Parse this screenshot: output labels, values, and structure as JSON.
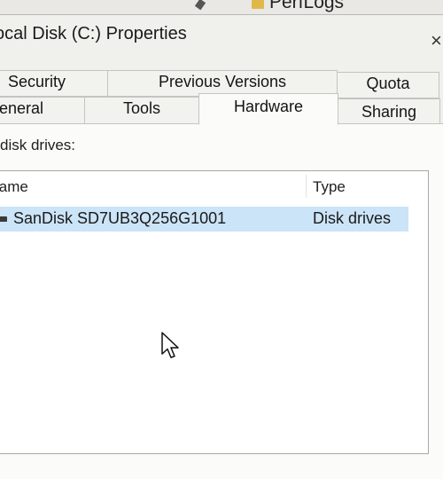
{
  "background": {
    "folder_label": "PerfLogs"
  },
  "dialog": {
    "title": "ocal Disk (C:) Properties",
    "close_glyph": "×"
  },
  "tabs": {
    "row_back": [
      {
        "label": "Security"
      },
      {
        "label": "Previous Versions"
      },
      {
        "label": "Quota"
      }
    ],
    "row_front": [
      {
        "label": "eneral"
      },
      {
        "label": "Tools"
      },
      {
        "label": "Hardware",
        "active": true
      },
      {
        "label": "Sharing"
      }
    ]
  },
  "hardware": {
    "section_label": "disk drives:",
    "columns": {
      "name": "lame",
      "type": "Type"
    },
    "rows": [
      {
        "name": "SanDisk SD7UB3Q256G1001",
        "type": "Disk drives",
        "selected": true
      }
    ]
  },
  "colors": {
    "selection": "#cce4f7",
    "panel": "#fbfbfa",
    "chrome": "#f0f0ed"
  },
  "icons": {
    "drive": "disk-drive-icon",
    "cursor": "mouse-pointer-icon",
    "close": "close-icon"
  }
}
